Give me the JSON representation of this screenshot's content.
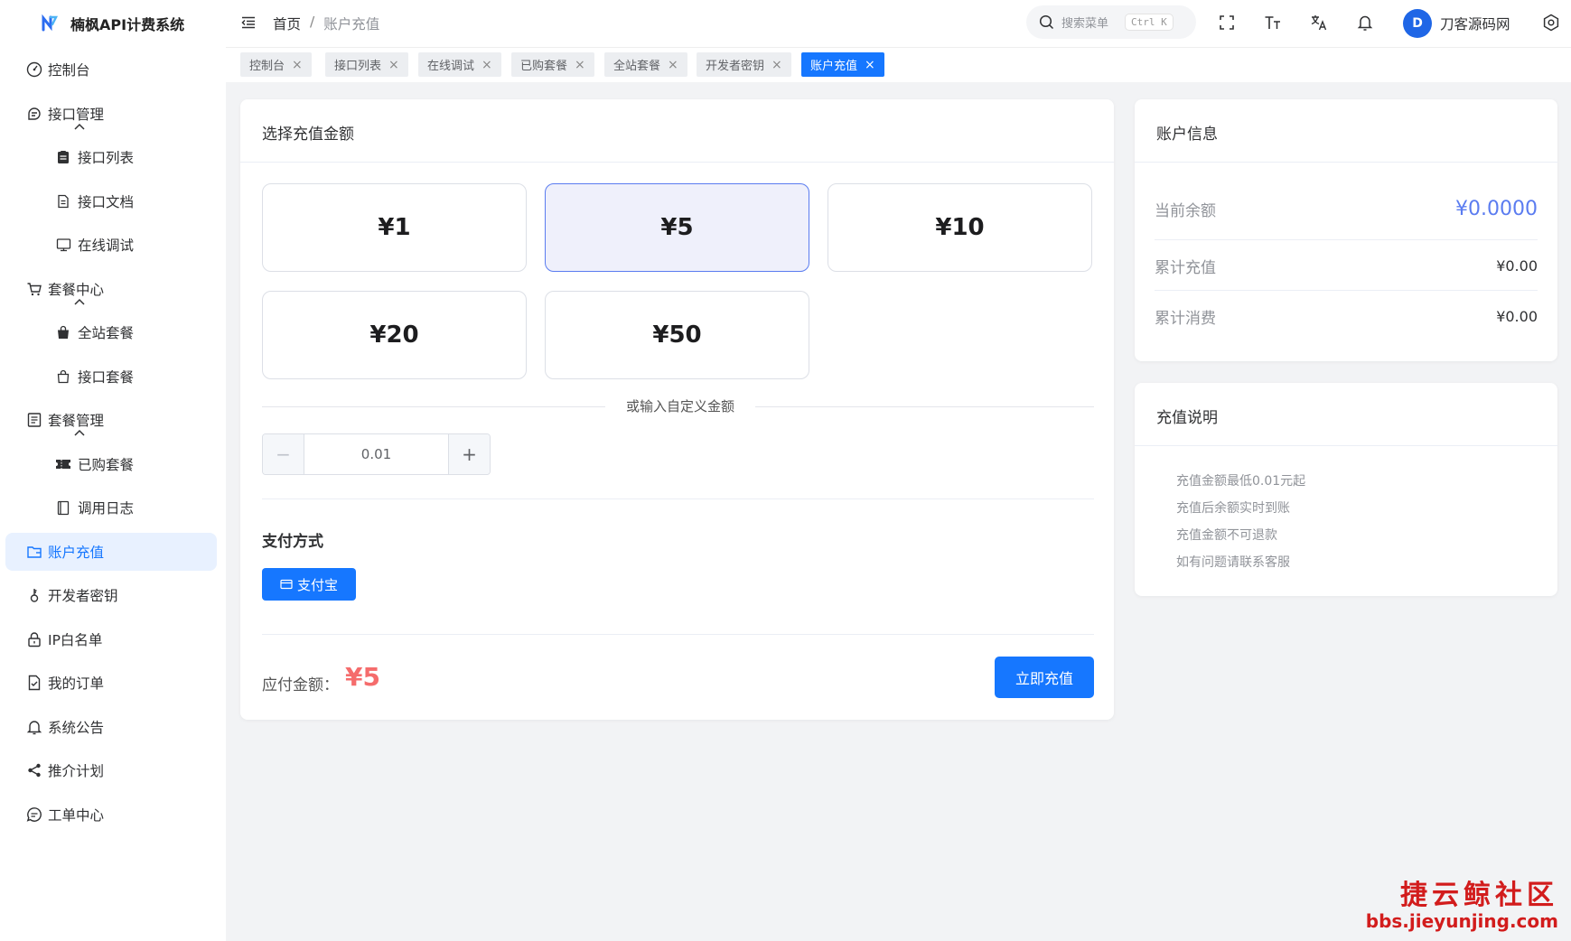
{
  "app": {
    "title": "楠枫API计费系统"
  },
  "sidebar": {
    "items": [
      {
        "label": "控制台",
        "icon": "dashboard-icon"
      },
      {
        "label": "接口管理",
        "icon": "api-icon"
      },
      {
        "label": "接口列表",
        "icon": "clipboard-list-icon"
      },
      {
        "label": "接口文档",
        "icon": "document-icon"
      },
      {
        "label": "在线调试",
        "icon": "monitor-icon"
      },
      {
        "label": "套餐中心",
        "icon": "cart-icon"
      },
      {
        "label": "全站套餐",
        "icon": "bag-icon"
      },
      {
        "label": "接口套餐",
        "icon": "bag-outline-icon"
      },
      {
        "label": "套餐管理",
        "icon": "list-icon"
      },
      {
        "label": "已购套餐",
        "icon": "ticket-icon"
      },
      {
        "label": "调用日志",
        "icon": "log-icon"
      },
      {
        "label": "账户充值",
        "icon": "wallet-icon"
      },
      {
        "label": "开发者密钥",
        "icon": "key-icon"
      },
      {
        "label": "IP白名单",
        "icon": "lock-icon"
      },
      {
        "label": "我的订单",
        "icon": "order-icon"
      },
      {
        "label": "系统公告",
        "icon": "bell-icon"
      },
      {
        "label": "推介计划",
        "icon": "share-icon"
      },
      {
        "label": "工单中心",
        "icon": "chat-icon"
      }
    ],
    "active_color": "#1677ff"
  },
  "header": {
    "breadcrumb": [
      "首页",
      "/",
      "账户充值"
    ],
    "search_placeholder": "搜索菜单",
    "search_shortcut": "Ctrl K",
    "avatar_letter": "D",
    "username": "刀客源码网"
  },
  "tabs": [
    {
      "label": "控制台",
      "close": "×"
    },
    {
      "label": "接口列表",
      "close": "×"
    },
    {
      "label": "在线调试",
      "close": "×"
    },
    {
      "label": "已购套餐",
      "close": "×"
    },
    {
      "label": "全站套餐",
      "close": "×"
    },
    {
      "label": "开发者密钥",
      "close": "×"
    },
    {
      "label": "账户充值",
      "close": "×"
    }
  ],
  "recharge": {
    "title": "选择充值金额",
    "options": [
      "¥1",
      "¥5",
      "¥10",
      "¥20",
      "¥50"
    ],
    "selected": "¥5",
    "custom_label": "或输入自定义金额",
    "custom_value": "0.01",
    "minus": "−",
    "plus": "+",
    "pay_method_title": "支付方式",
    "pay_method": "支付宝",
    "due_label": "应付金额：",
    "due_value": "¥5",
    "submit": "立即充值"
  },
  "account": {
    "title": "账户信息",
    "rows": [
      {
        "label": "当前余额",
        "value": "¥0.0000"
      },
      {
        "label": "累计充值",
        "value": "¥0.00"
      },
      {
        "label": "累计消费",
        "value": "¥0.00"
      }
    ]
  },
  "notes": {
    "title": "充值说明",
    "items": [
      "充值金额最低0.01元起",
      "充值后余额实时到账",
      "充值金额不可退款",
      "如有问题请联系客服"
    ]
  },
  "watermark": {
    "line1": "捷云鲸社区",
    "line2": "bbs.jieyunjing.com"
  },
  "colors": {
    "primary": "#1677ff",
    "accent": "#5b7cf0",
    "danger": "#f56c6c"
  }
}
